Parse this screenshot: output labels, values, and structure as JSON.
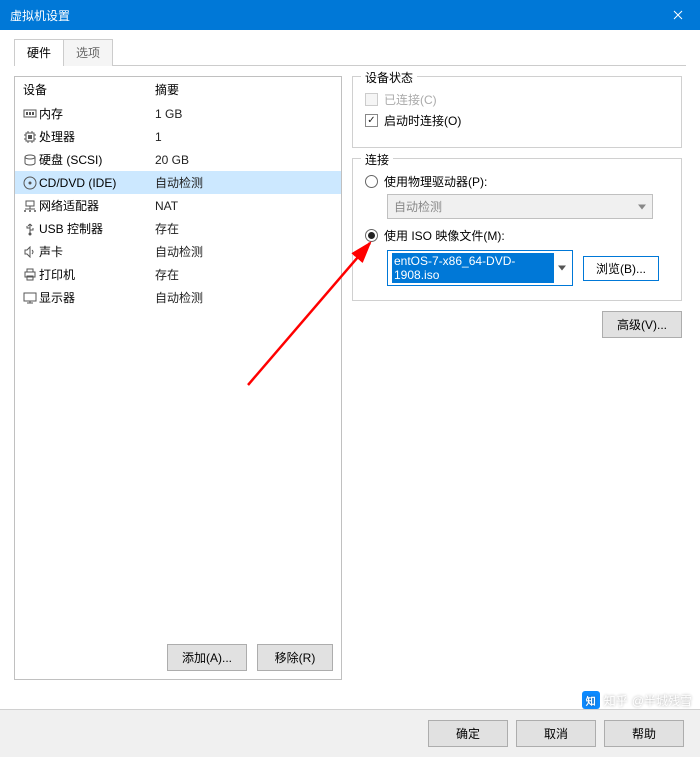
{
  "titlebar": {
    "title": "虚拟机设置"
  },
  "tabs": {
    "hardware": "硬件",
    "options": "选项"
  },
  "list_header": {
    "device": "设备",
    "summary": "摘要"
  },
  "devices": [
    {
      "icon": "memory-icon",
      "label": "内存",
      "summary": "1 GB"
    },
    {
      "icon": "cpu-icon",
      "label": "处理器",
      "summary": "1"
    },
    {
      "icon": "disk-icon",
      "label": "硬盘 (SCSI)",
      "summary": "20 GB"
    },
    {
      "icon": "cd-icon",
      "label": "CD/DVD (IDE)",
      "summary": "自动检测",
      "selected": true
    },
    {
      "icon": "network-icon",
      "label": "网络适配器",
      "summary": "NAT"
    },
    {
      "icon": "usb-icon",
      "label": "USB 控制器",
      "summary": "存在"
    },
    {
      "icon": "sound-icon",
      "label": "声卡",
      "summary": "自动检测"
    },
    {
      "icon": "printer-icon",
      "label": "打印机",
      "summary": "存在"
    },
    {
      "icon": "display-icon",
      "label": "显示器",
      "summary": "自动检测"
    }
  ],
  "list_buttons": {
    "add": "添加(A)...",
    "remove": "移除(R)"
  },
  "status_group": {
    "title": "设备状态",
    "connected": "已连接(C)",
    "connect_at_power": "启动时连接(O)"
  },
  "connection_group": {
    "title": "连接",
    "physical": "使用物理驱动器(P):",
    "physical_value": "自动检测",
    "iso": "使用 ISO 映像文件(M):",
    "iso_value": "entOS-7-x86_64-DVD-1908.iso",
    "browse": "浏览(B)..."
  },
  "advanced": "高级(V)...",
  "footer": {
    "ok": "确定",
    "cancel": "取消",
    "help": "帮助"
  },
  "watermark": {
    "brand": "知乎",
    "author": "@半城残雪"
  }
}
